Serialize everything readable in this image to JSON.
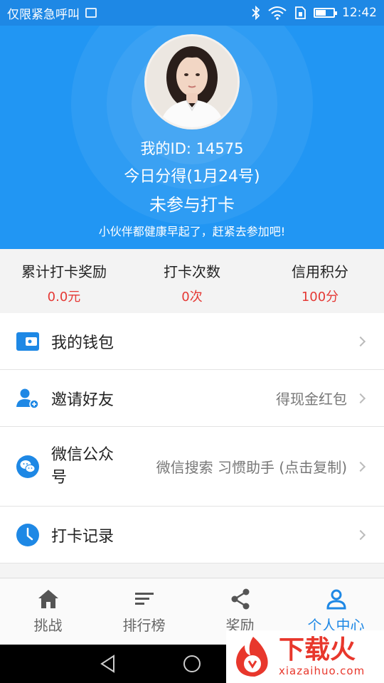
{
  "status_bar": {
    "carrier": "仅限紧急呼叫",
    "time": "12:42"
  },
  "header": {
    "my_id": "我的ID: 14575",
    "today_earned": "今日分得(1月24号)",
    "checkin_status": "未参与打卡",
    "slogan": "小伙伴都健康早起了，赶紧去参加吧!"
  },
  "stats": [
    {
      "label": "累计打卡奖励",
      "value": "0.0元"
    },
    {
      "label": "打卡次数",
      "value": "0次"
    },
    {
      "label": "信用积分",
      "value": "100分"
    }
  ],
  "menu": [
    {
      "title": "我的钱包",
      "hint": "",
      "icon": "wallet-icon"
    },
    {
      "title": "邀请好友",
      "hint": "得现金红包",
      "icon": "invite-user-icon"
    },
    {
      "title": "微信公众号",
      "hint": "微信搜索 习惯助手 (点击复制)",
      "icon": "wechat-icon"
    },
    {
      "title": "打卡记录",
      "hint": "",
      "icon": "clock-icon"
    }
  ],
  "bottom_nav": [
    {
      "label": "挑战",
      "icon": "home-icon",
      "active": false
    },
    {
      "label": "排行榜",
      "icon": "ranking-icon",
      "active": false
    },
    {
      "label": "奖励",
      "icon": "share-icon",
      "active": false
    },
    {
      "label": "个人中心",
      "icon": "person-icon",
      "active": true
    }
  ],
  "watermark": {
    "main": "下载火",
    "sub": "xiazaihuo.com"
  },
  "colors": {
    "primary": "#2196f3",
    "status_bar": "#1e88e5",
    "accent_red": "#e53935"
  }
}
